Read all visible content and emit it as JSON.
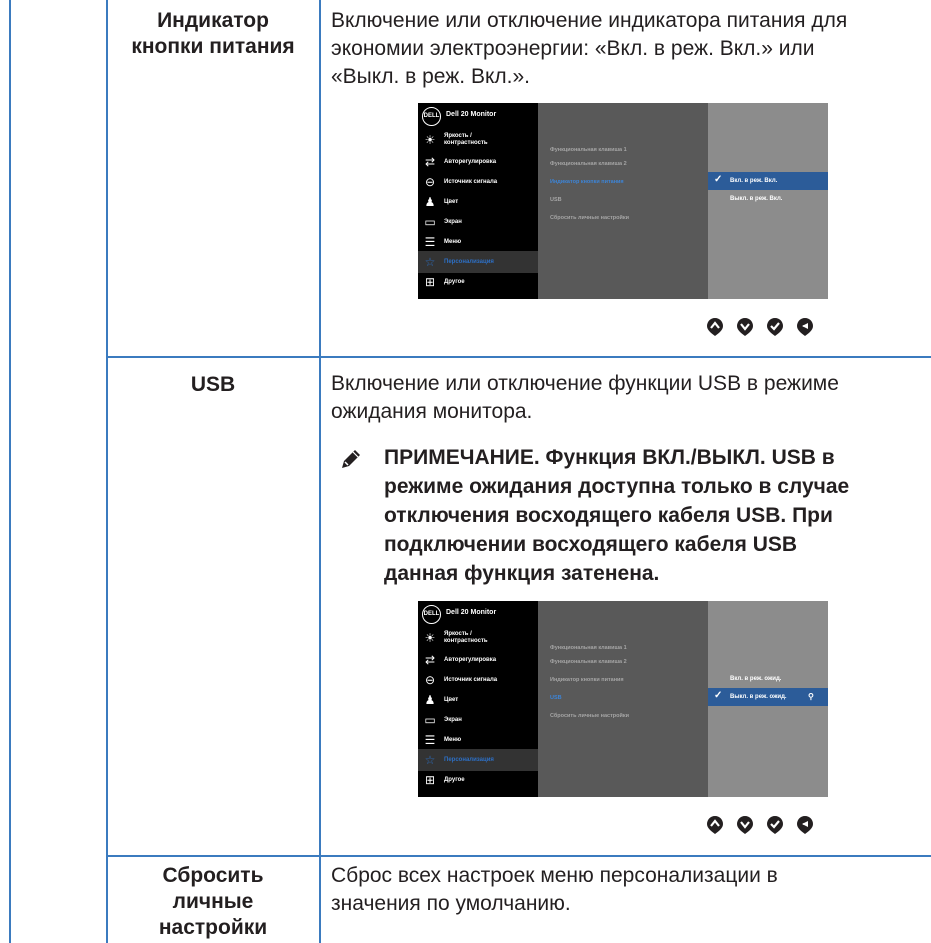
{
  "rows": [
    {
      "label_lines": [
        "Индикатор",
        "кнопки питания"
      ],
      "desc_lines": [
        "Включение или отключение индикатора питания для",
        "экономии электроэнергии: «Вкл. в реж. Вкл.» или",
        "«Выкл. в реж. Вкл.»."
      ]
    },
    {
      "label_lines": [
        "USB"
      ],
      "desc_lines": [
        "Включение или отключение функции USB в режиме",
        "ожидания монитора."
      ],
      "note_lines": [
        "ПРИМЕЧАНИЕ. Функция ВКЛ./ВЫКЛ. USB в",
        "режиме ожидания доступна только в случае",
        "отключения восходящего кабеля USB. При",
        "подключении восходящего кабеля USB",
        "данная функция затенена."
      ]
    },
    {
      "label_lines": [
        "Сбросить",
        "личные",
        "настройки"
      ],
      "desc_lines": [
        "Сброс всех настроек меню персонализации в",
        "значения по умолчанию."
      ]
    }
  ],
  "osd": {
    "logo": "DELL",
    "title": "Dell 20 Monitor",
    "menu": [
      {
        "label": "Яркость /\nконтрастность",
        "icon": "brightness-icon",
        "glyph": "☀"
      },
      {
        "label": "Авторегулировка",
        "icon": "auto-adjust-icon",
        "glyph": "⇄"
      },
      {
        "label": "Источник сигнала",
        "icon": "input-source-icon",
        "glyph": "⊖"
      },
      {
        "label": "Цвет",
        "icon": "color-icon",
        "glyph": "♟"
      },
      {
        "label": "Экран",
        "icon": "display-icon",
        "glyph": "▭"
      },
      {
        "label": "Меню",
        "icon": "menu-icon",
        "glyph": "☰"
      },
      {
        "label": "Персонализация",
        "icon": "star-icon",
        "glyph": "☆"
      },
      {
        "label": "Другое",
        "icon": "other-icon",
        "glyph": "⊞"
      }
    ],
    "submenu": [
      "Функциональная клавиша 1",
      "Функциональная клавиша 2",
      "Индикатор кнопки питания",
      "USB",
      "Сбросить личные настройки"
    ],
    "osd1_options": [
      "Вкл. в реж. Вкл.",
      "Выкл. в реж. Вкл."
    ],
    "osd2_options": [
      "Вкл. в реж. ожид.",
      "Выкл. в реж. ожид."
    ],
    "checkmark": "✓",
    "usb_icon": "⚲",
    "nav_icons": [
      "nav-up-icon",
      "nav-down-icon",
      "nav-ok-icon",
      "nav-back-icon"
    ]
  },
  "colors": {
    "rule": "#3b7bbf",
    "osd_bg": "#8c8c8c",
    "osd_highlight": "#2d6fc4"
  }
}
